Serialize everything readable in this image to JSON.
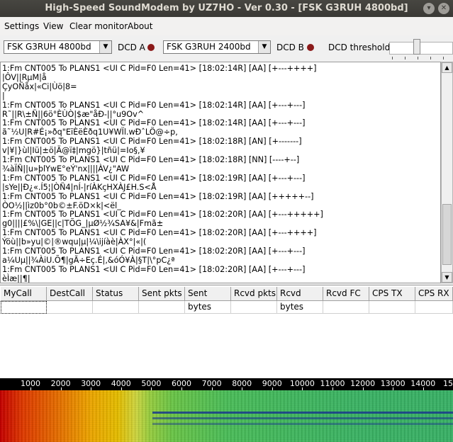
{
  "window": {
    "title": "High-Speed SoundModem by UZ7HO - Ver 0.30 - [FSK G3RUH 4800bd]",
    "minimize_glyph": "▾",
    "close_glyph": "✕"
  },
  "menu": {
    "settings": "Settings",
    "view": "View",
    "clear_monitor": "Clear monitor",
    "about": "About"
  },
  "toolbar": {
    "modem_a": "FSK G3RUH 4800bd",
    "dcd_a_label": "DCD A",
    "modem_b": "FSK G3RUH 2400bd",
    "dcd_b_label": "DCD B",
    "dcd_threshold_label": "DCD threshold",
    "dropdown_glyph": "▼",
    "dcd_led_color": "#8b1a1a",
    "dcd_threshold_fraction": 0.4
  },
  "monitor": {
    "lines": [
      "1:Fm CNT005 To PLANS1 <UI C Pid=F0 Len=41> [18:02:14R] [AA] [+---++++]",
      "|ÔV||RµM|å",
      "ÇyOÑåx|«Ci|Ùö|8=",
      "|",
      "1:Fm CNT005 To PLANS1 <UI C Pid=F0 Len=41> [18:02:14R] [AA] [+---+---]",
      "R˜||R\\±Ñ||6ö°ÈÙÒ|$æ\"åÐ-||°u9Ov^",
      "1:Fm CNT005 To PLANS1 <UI C Pid=F0 Len=41> [18:02:14R] [AA] [+---+---]",
      "ã˜½U|R#É¡»ðq\"EïÈëÈðq1U¥WÏl.wÐˆLÖ@÷p,",
      "1:Fm CNT005 To PLANS1 <UI C Pid=F0 Len=41> [18:02:18R] [AN] [+-------]",
      "v|¥|}ùl|Iü|±ö|Ä@ï‡|mgö}|tñü|=Io§,¥",
      "1:Fm CNT005 To PLANS1 <UI C Pid=F0 Len=41> [18:02:18R] [NN] [----+--]",
      "¾àÏÑ||u»þlYwE°eÝ'nx||||ÀV¿\"AW",
      "1:Fm CNT005 To PLANS1 <UI C Pid=F0 Len=41> [18:02:19R] [AA] [+---+---]",
      "|sYe||Ð¿«.Í5¦|ÒÑ4|nÍ-|ríÀKçHXÀJ£H.S<Å",
      "1:Fm CNT005 To PLANS1 <UI C Pid=F0 Len=41> [18:02:19R] [AA] [+++++--]",
      "ÒO½||ìz0b°0b©±F.öD×k|<ël_",
      "1:Fm CNT005 To PLANS1 <UI C Pid=F0 Len=41> [18:02:20R] [AA] [+---+++++]",
      "g0||||£%\\|GE||c|TÕG_|µØ½¾SA¥&|Fmã±",
      "1:Fm CNT005 To PLANS1 <UI C Pid=F0 Len=41> [18:02:20R] [AA] [+---++++]",
      "Ýöù||b»yu|©|®wqu|µ|¼\\ijíàè|ÀX°|«|(",
      "1:Fm CNT005 To PLANS1 <UI C Pid=F0 Len=41> [18:02:20R] [AA] [+---+---]",
      "a¼Uµ||¾ÀiU.Õ¶|gÃ÷Eç.É|,&óÓ¥À|§T|\\°pC¿ª",
      "1:Fm CNT005 To PLANS1 <UI C Pid=F0 Len=41> [18:02:20R] [AA] [+---+---]",
      "èÌæ||¶|"
    ]
  },
  "scrollbar": {
    "up_glyph": "▲",
    "down_glyph": "▼"
  },
  "grid": {
    "columns": [
      "MyCall",
      "DestCall",
      "Status",
      "Sent pkts",
      "Sent bytes",
      "Rcvd pkts",
      "Rcvd bytes",
      "Rcvd FC",
      "CPS TX",
      "CPS RX"
    ]
  },
  "waterfall": {
    "scale": [
      "1000",
      "2000",
      "3000",
      "4000",
      "5000",
      "6000",
      "7000",
      "8000",
      "9000",
      "10000",
      "11000",
      "12000",
      "13000",
      "14000",
      "15"
    ]
  }
}
